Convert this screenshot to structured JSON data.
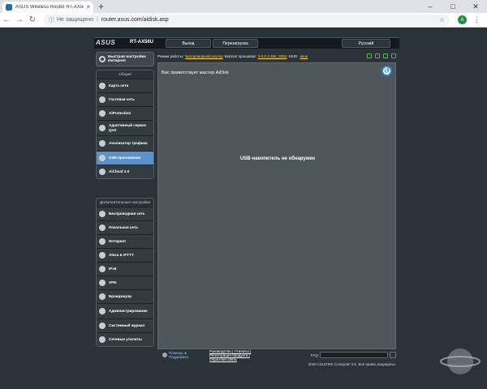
{
  "browser": {
    "tab_title": "ASUS Wireless Router RT-AX56U",
    "tab_close": "×",
    "new_tab": "+",
    "security_label": "Не защищено",
    "url": "router.asus.com/aidisk.asp",
    "profile_initial": "A"
  },
  "router": {
    "logo": "ASUS",
    "model": "RT-AX56U",
    "logout_label": "Выход",
    "reboot_label": "Перезагрузка",
    "language": "Русский",
    "status": {
      "mode_label": "Режим работы:",
      "mode_value": "Беспроводной роутер",
      "firmware_label": "Версия прошивки:",
      "firmware_value": "3.0.0.4.384_8253",
      "ssid_label": "SSID:",
      "ssid_value": "asus"
    },
    "sidebar": {
      "quick_setup": "Быстрая настройка Интернет",
      "general_title": "Общие",
      "general_items": [
        {
          "label": "Карта сети"
        },
        {
          "label": "Гостевая сеть"
        },
        {
          "label": "AiProtection"
        },
        {
          "label": "Адаптивный сервис QoS"
        },
        {
          "label": "Анализатор трафика"
        },
        {
          "label": "USB-приложение"
        },
        {
          "label": "AiCloud 2.0"
        }
      ],
      "advanced_title": "Дополнительные настройки",
      "advanced_items": [
        {
          "label": "Беспроводная сеть"
        },
        {
          "label": "Локальная сеть"
        },
        {
          "label": "Интернет"
        },
        {
          "label": "Alexa & IFTTT"
        },
        {
          "label": "IPv6"
        },
        {
          "label": "VPN"
        },
        {
          "label": "Брандмауэр"
        },
        {
          "label": "Администрирование"
        },
        {
          "label": "Системный журнал"
        },
        {
          "label": "Сетевые утилиты"
        }
      ]
    },
    "main": {
      "title": "Вас приветствует мастер AiDisk",
      "message": "USB-накопитель не обнаружен"
    },
    "footer": {
      "help": "Помощь & Поддержка",
      "links": "Руководство | Утилиты | Регистрация продукта | Обратная связь",
      "faq": "FAQ",
      "copyright": "2020 ASUSTeK Computer Inc. Все права защищены."
    }
  },
  "colors": {
    "accent": "#5b92c9",
    "status_link": "#ffd34d",
    "background": "#2b3338"
  }
}
